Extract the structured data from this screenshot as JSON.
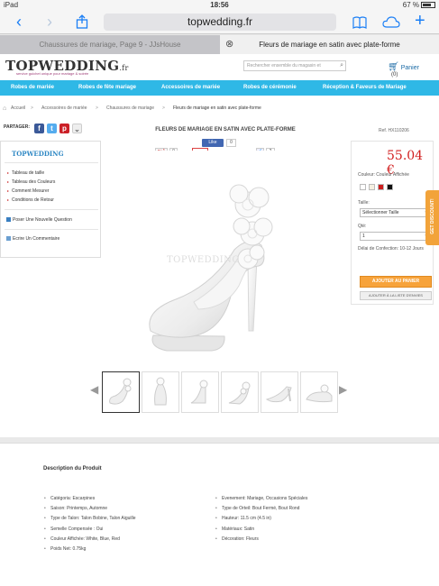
{
  "status_bar": {
    "carrier": "iPad",
    "time": "18:56",
    "battery": "67 %"
  },
  "browser": {
    "url": "topwedding.fr",
    "tabs": [
      {
        "label": "Chaussures de mariage, Page 9 - JJsHouse"
      },
      {
        "label": "Fleurs de mariage en satin avec plate-forme"
      }
    ]
  },
  "site": {
    "logo": "TOPWEDDING",
    "logo_suffix": ".fr",
    "tagline": "service guichet unique pour mariage & soirée",
    "search_placeholder": "Rechercher ensemble du magasin et",
    "cart_label": "Panier",
    "cart_count": "(0)",
    "nav": [
      "Robes de mariée",
      "Robes de fête mariage",
      "Accessoires de mariée",
      "Robes de cérémonie",
      "Réception & Faveurs de Mariage"
    ]
  },
  "breadcrumb": [
    "Accueil",
    "Accessoires de mariée",
    "Chaussures de mariage",
    "Fleurs de mariage en satin avec plate-forme"
  ],
  "share": {
    "label": "PARTAGER:",
    "fb_like": "Like",
    "fb_count": "0",
    "gplus_count": "0",
    "pin_label": "Pin it",
    "tw_count": "2"
  },
  "product": {
    "title": "FLEURS DE MARIAGE EN SATIN AVEC PLATE-FORME",
    "ref": "Ref. HX110206",
    "price": "55.04 €",
    "color_label": "Couleur: Couleur Affichée",
    "swatch_colors": [
      "#ffffff",
      "#f5f0e1",
      "#cc1e1e",
      "#111111"
    ],
    "size_label": "Taille:",
    "size_select": "Sélectionner Taille",
    "qty_label": "Qté:",
    "qty_value": "1",
    "delay": "Délai de Confection: 10-12 Jours",
    "add_to_cart": "AJOUTER AU PANIER",
    "add_to_list": "AJOUTER À LA LISTE D'ENVIES",
    "watermark": "TOPWEDDING"
  },
  "sidebar": {
    "logo": "TOPWEDDING",
    "links": [
      "Tableau de taille",
      "Tableau des Couleurs",
      "Comment Mesurer",
      "Conditions de Retour"
    ],
    "actions": [
      "Poser Une Nouvelle Question",
      "Ecrire Un Commentaire"
    ]
  },
  "discount_tab": "GET DISCOUNT!",
  "description": {
    "title": "Description du Produit",
    "left": [
      "Catégoria: Escarpines",
      "Saison: Printemps, Automne",
      "Type de Talon: Talon Bobine, Talon Aiguille",
      "Semelle Compensée : Oui",
      "Couleur Affichée: White, Blue, Red",
      "Poids Net: 0.75kg"
    ],
    "right": [
      "Evenement: Mariage, Occasions Spéciales",
      "Type de Orteil: Bout Fermé, Bout Rond",
      "Hauteur: 11.5 cm (4.5 in)",
      "Matériaux: Satin",
      "Décoration: Fleurs"
    ]
  }
}
